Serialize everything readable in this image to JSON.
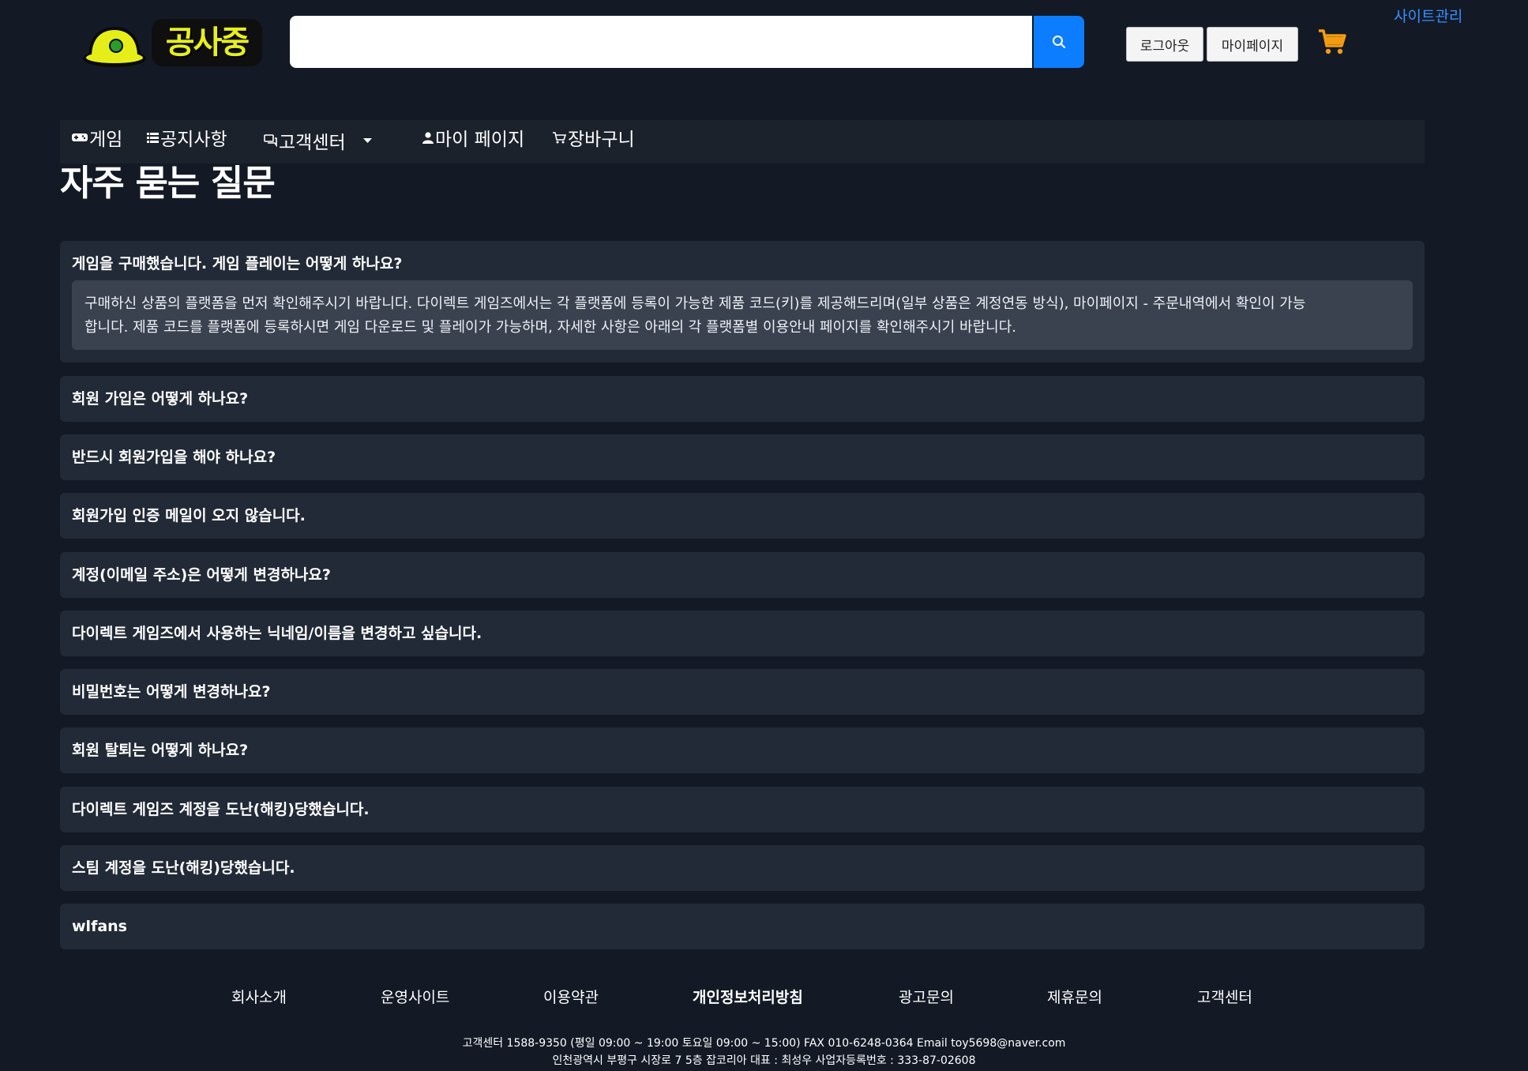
{
  "header": {
    "admin_link": "사이트관리",
    "logo_text": "공사중",
    "search": {
      "value": "",
      "placeholder": ""
    },
    "logout_label": "로그아웃",
    "mypage_label": "마이페이지",
    "colors": {
      "search_button": "#0d7dff",
      "cart": "#f39c12",
      "admin_link": "#3a8dff"
    }
  },
  "nav": {
    "items": [
      {
        "label": "게임",
        "icon": "gamepad-icon"
      },
      {
        "label": "공지사항",
        "icon": "list-icon"
      },
      {
        "label": "고객센터",
        "icon": "chat-icon"
      },
      {
        "label": "마이 페이지",
        "icon": "user-icon"
      },
      {
        "label": "장바구니",
        "icon": "cart-icon"
      }
    ]
  },
  "page": {
    "title": "자주 묻는 질문"
  },
  "faq": {
    "items": [
      {
        "question": "게임을 구매했습니다. 게임 플레이는 어떻게 하나요?",
        "answer_line1": "구매하신 상품의 플랫폼을 먼저 확인해주시기 바랍니다. 다이렉트 게임즈에서는 각 플랫폼에 등록이 가능한 제품 코드(키)를 제공해드리며(일부 상품은 계정연동 방식), 마이페이지 - 주문내역에서 확인이 가능",
        "answer_line2": "합니다. 제품 코드를 플랫폼에 등록하시면 게임 다운로드 및 플레이가 가능하며, 자세한 사항은 아래의 각 플랫폼별 이용안내 페이지를 확인해주시기 바랍니다."
      },
      {
        "question": "회원 가입은 어떻게 하나요?"
      },
      {
        "question": "반드시 회원가입을 해야 하나요?"
      },
      {
        "question": "회원가입 인증 메일이 오지 않습니다."
      },
      {
        "question": "계정(이메일 주소)은 어떻게 변경하나요?"
      },
      {
        "question": "다이렉트 게임즈에서 사용하는 닉네임/이름을 변경하고 싶습니다."
      },
      {
        "question": "비밀번호는 어떻게 변경하나요?"
      },
      {
        "question": "회원 탈퇴는 어떻게 하나요?"
      },
      {
        "question": "다이렉트 게임즈 계정을 도난(해킹)당했습니다."
      },
      {
        "question": "스팀 계정을 도난(해킹)당했습니다."
      },
      {
        "question": "wlfans"
      }
    ]
  },
  "footer": {
    "links": [
      "회사소개",
      "운영사이트",
      "이용약관",
      "개인정보처리방침",
      "광고문의",
      "제휴문의",
      "고객센터"
    ],
    "info_line1": "고객센터 1588-9350 (평일 09:00 ~ 19:00 토요일 09:00 ~ 15:00) FAX 010-6248-0364 Email toy5698@naver.com",
    "info_line2": "인천광역시 부평구 시장로 7 5층 잡코리아 대표 : 최성우 사업자등록번호 : 333-87-02608"
  }
}
